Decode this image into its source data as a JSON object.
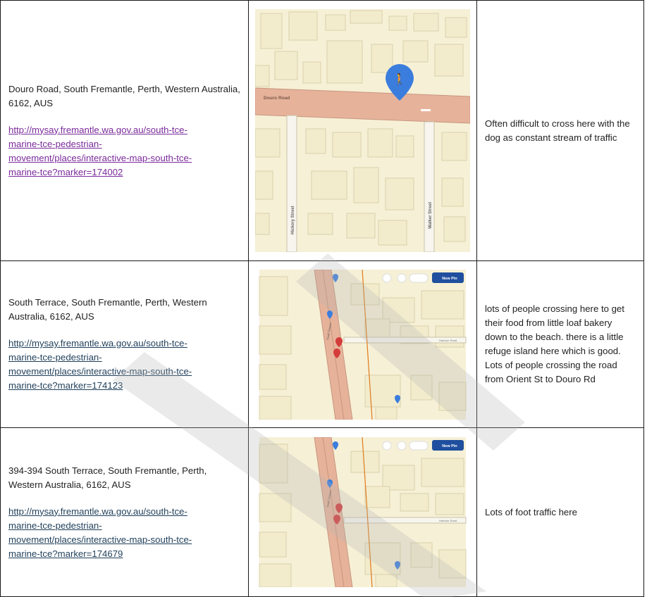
{
  "rows": [
    {
      "address": "Douro Road, South Fremantle, Perth, Western Australia, 6162, AUS",
      "link": "http://mysay.fremantle.wa.gov.au/south-tce-marine-tce-pedestrian-movement/places/interactive-map-south-tce-marine-tce?marker=174002",
      "link_lines": [
        "http://mysay.fremantle.wa.gov.au/south-tce-",
        "marine-tce-pedestrian-",
        "movement/places/interactive-map-south-tce-",
        "marine-tce?marker=174002"
      ],
      "comment": "Often difficult to cross here with the dog as constant stream of traffic",
      "map": {
        "road_label": "Douro Road",
        "street_left": "Hickory Street",
        "street_right": "Walker Street"
      }
    },
    {
      "address": "South Terrace, South Fremantle, Perth, Western Australia, 6162, AUS",
      "link": "http://mysay.fremantle.wa.gov.au/south-tce-marine-tce-pedestrian-movement/places/interactive-map-south-tce-marine-tce?marker=174123",
      "link_lines": [
        "http://mysay.fremantle.wa.gov.au/south-tce-",
        "marine-tce-pedestrian-",
        "movement/places/interactive-map-south-tce-",
        "marine-tce?marker=174123"
      ],
      "comment": "lots of people crossing here to get their food from little loaf bakery down to the beach. there is a little refuge island here which is good. Lots of people crossing the road from Orient St to Douro Rd",
      "map": {
        "new_pin_label": "New Pin",
        "street_vertical": "South Terrace",
        "street_side": "Harbour Road"
      }
    },
    {
      "address": "394-394 South Terrace, South Fremantle, Perth, Western Australia, 6162, AUS",
      "link": "http://mysay.fremantle.wa.gov.au/south-tce-marine-tce-pedestrian-movement/places/interactive-map-south-tce-marine-tce?marker=174679",
      "link_lines": [
        "http://mysay.fremantle.wa.gov.au/south-tce-",
        "marine-tce-pedestrian-",
        "movement/places/interactive-map-south-tce-",
        "marine-tce?marker=174679"
      ],
      "comment": "Lots of foot traffic here",
      "map": {
        "new_pin_label": "New Pin",
        "street_vertical": "South Terrace",
        "street_side": "Harbour Road"
      }
    }
  ],
  "colors": {
    "map_bg": "#f6f0d6",
    "building": "#f2eccd",
    "building_stroke": "#d9d0a9",
    "road": "#e6b39a",
    "road_stroke": "#c9957e",
    "pin_blue": "#3b7ddd",
    "pin_red": "#d43b3b",
    "new_pin_btn": "#1f4f9e",
    "watermark": "#b5b5b5"
  }
}
